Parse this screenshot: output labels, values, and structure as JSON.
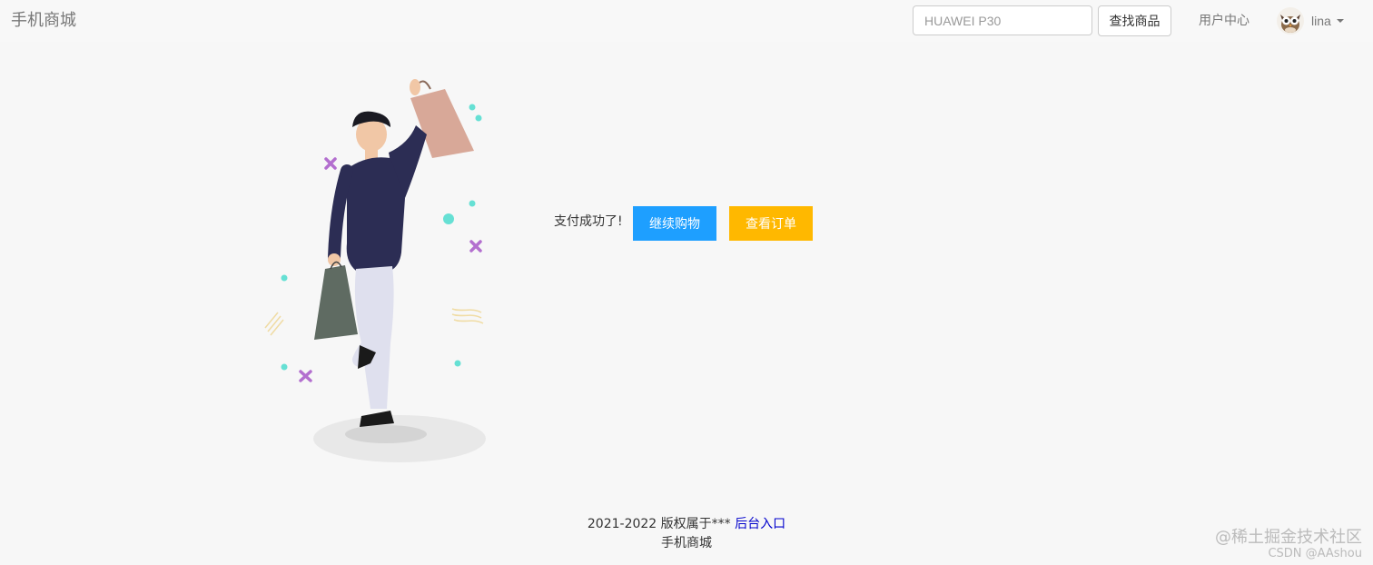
{
  "navbar": {
    "brand": "手机商城",
    "search": {
      "value": "",
      "placeholder": "HUAWEI P30"
    },
    "search_button": "查找商品",
    "user_center": "用户中心",
    "username": "lina",
    "avatar_icon": "owl-avatar-icon"
  },
  "main": {
    "message": "支付成功了!",
    "continue_button": "继续购物",
    "orders_button": "查看订单",
    "illustration_icon": "shopping-man-illustration"
  },
  "footer": {
    "copyright": "2021-2022 版权属于***",
    "admin_link": "后台入口",
    "site_name": "手机商城"
  },
  "watermark": {
    "line1": "@稀土掘金技术社区",
    "line2": "CSDN @AAshou"
  },
  "colors": {
    "continue_button": "#1e9fff",
    "orders_button": "#ffb800",
    "link": "#0000cc"
  }
}
